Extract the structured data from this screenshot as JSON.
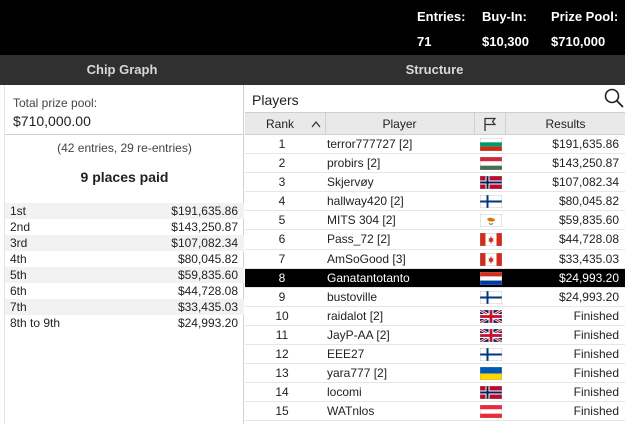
{
  "header": {
    "entries_label": "Entries:",
    "entries_value": "71",
    "buyin_label": "Buy-In:",
    "buyin_value": "$10,300",
    "prize_label": "Prize Pool:",
    "prize_value": "$710,000"
  },
  "tabs": [
    {
      "label": "Chip Graph"
    },
    {
      "label": "Structure"
    }
  ],
  "left": {
    "pool_label": "Total prize pool:",
    "pool_value": "$710,000.00",
    "entries_note": "(42 entries, 29 re-entries)",
    "places_paid": "9 places paid",
    "payouts": [
      {
        "place": "1st",
        "amount": "$191,635.86"
      },
      {
        "place": "2nd",
        "amount": "$143,250.87"
      },
      {
        "place": "3rd",
        "amount": "$107,082.34"
      },
      {
        "place": "4th",
        "amount": "$80,045.82"
      },
      {
        "place": "5th",
        "amount": "$59,835.60"
      },
      {
        "place": "6th",
        "amount": "$44,728.08"
      },
      {
        "place": "7th",
        "amount": "$33,435.03"
      },
      {
        "place": "8th to 9th",
        "amount": "$24,993.20"
      }
    ]
  },
  "players": {
    "title": "Players",
    "columns": {
      "rank": "Rank",
      "player": "Player",
      "results": "Results"
    },
    "search_icon": "search-icon",
    "rows": [
      {
        "rank": "1",
        "name": "terror777727 [2]",
        "flag": "bg",
        "result": "$191,635.86"
      },
      {
        "rank": "2",
        "name": "probirs [2]",
        "flag": "hu",
        "result": "$143,250.87"
      },
      {
        "rank": "3",
        "name": "Skjervøy",
        "flag": "no",
        "result": "$107,082.34"
      },
      {
        "rank": "4",
        "name": "hallway420 [2]",
        "flag": "fi",
        "result": "$80,045.82"
      },
      {
        "rank": "5",
        "name": "MITS 304 [2]",
        "flag": "cy",
        "result": "$59,835.60"
      },
      {
        "rank": "6",
        "name": "Pass_72 [2]",
        "flag": "ca",
        "result": "$44,728.08"
      },
      {
        "rank": "7",
        "name": "AmSoGood [3]",
        "flag": "ca",
        "result": "$33,435.03"
      },
      {
        "rank": "8",
        "name": "Ganatantotanto",
        "flag": "py",
        "result": "$24,993.20",
        "selected": true
      },
      {
        "rank": "9",
        "name": "bustoville",
        "flag": "fi",
        "result": "$24,993.20"
      },
      {
        "rank": "10",
        "name": "raidalot [2]",
        "flag": "gb",
        "result": "Finished"
      },
      {
        "rank": "11",
        "name": "JayP-AA [2]",
        "flag": "gb",
        "result": "Finished"
      },
      {
        "rank": "12",
        "name": "EEE27",
        "flag": "fi",
        "result": "Finished"
      },
      {
        "rank": "13",
        "name": "yara777 [2]",
        "flag": "ua",
        "result": "Finished"
      },
      {
        "rank": "14",
        "name": "locomi",
        "flag": "no",
        "result": "Finished"
      },
      {
        "rank": "15",
        "name": "WATnlos",
        "flag": "at",
        "result": "Finished"
      }
    ]
  },
  "colors": {
    "header_bg": "#000000",
    "tab_bg": "#303030",
    "selected_row": "#000000"
  }
}
